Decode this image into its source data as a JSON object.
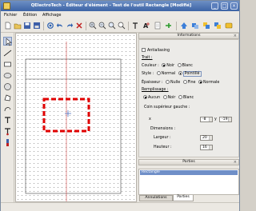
{
  "window": {
    "title": "QElectroTech - Éditeur d'élément - Test de l'outil Rectangle [Modifié]",
    "buttons": {
      "minimize": "_",
      "maximize": "□",
      "close": "×"
    }
  },
  "menubar": {
    "items": [
      "Fichier",
      "Édition",
      "Affichage"
    ]
  },
  "toolbar": {
    "icons": [
      "new-icon",
      "open-icon",
      "save-icon",
      "save-as-icon",
      "reload-icon",
      "undo-icon",
      "redo-icon",
      "delete-icon",
      "zoom-in-icon",
      "zoom-out-icon",
      "zoom-fit-icon",
      "zoom-reset-icon",
      "text-icon",
      "add-terminal-icon",
      "raise-icon",
      "lower-icon",
      "move-up-icon",
      "move-down-icon",
      "send-back-icon"
    ]
  },
  "tools": {
    "items": [
      "select-tool",
      "line-tool",
      "rectangle-tool",
      "ellipse-tool",
      "circle-tool",
      "polygon-tool",
      "arc-tool",
      "text-tool",
      "terminal-tool",
      "textfield-tool"
    ]
  },
  "info_panel": {
    "header": "Informations",
    "antialiasing": "Antialiasing",
    "trait": "Trait :",
    "couleur_label": "Couleur :",
    "couleur_noir": "Noir",
    "couleur_blanc": "Blanc",
    "style_label": "Style :",
    "style_normal": "Normal",
    "style_pointille": "Pointillé",
    "epaisseur_label": "Épaisseur :",
    "epaisseur_nulle": "Nulle",
    "epaisseur_fine": "Fine",
    "epaisseur_normale": "Normale",
    "remplissage": "Remplissage :",
    "remplissage_aucun": "Aucun",
    "remplissage_noir": "Noir",
    "remplissage_blanc": "Blanc",
    "coin_label": "Coin supérieur gauche :",
    "x_label": "x",
    "x_value": "-8",
    "y_label": "y",
    "y_value": "-19",
    "dimensions": "Dimensions :",
    "largeur_label": "Largeur :",
    "largeur_value": "20",
    "hauteur_label": "Hauteur :",
    "hauteur_value": "16"
  },
  "parts_panel": {
    "header": "Parties",
    "items": [
      "Rectangle"
    ],
    "tabs": [
      "Annulations",
      "Parties"
    ]
  },
  "colors": {
    "selection_dash": "#e00000",
    "axis_red": "#d04040",
    "highlight": "#6f8fc8"
  }
}
